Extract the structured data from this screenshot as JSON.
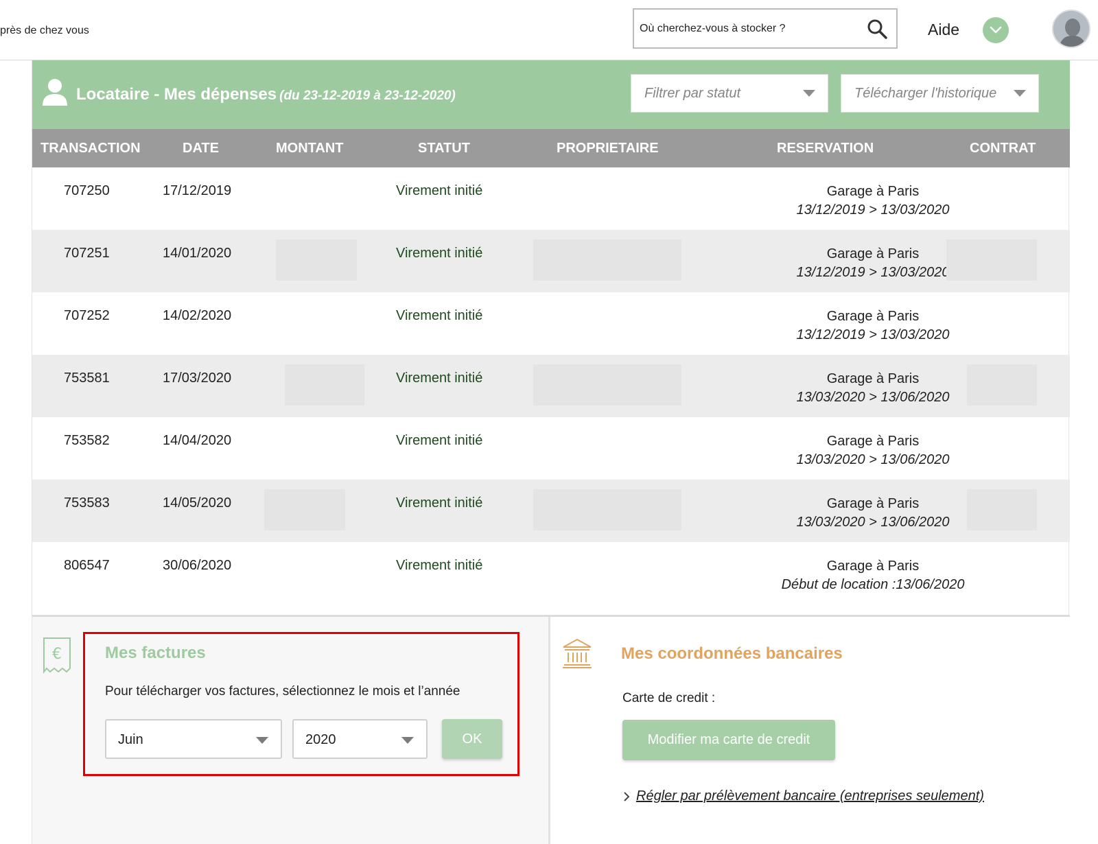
{
  "header": {
    "tagline": "près de chez vous",
    "search_placeholder": "Où cherchez-vous à stocker ?",
    "help_label": "Aide"
  },
  "panel": {
    "title": "Locataire - Mes dépenses",
    "date_range": "(du 23-12-2019 à 23-12-2020)",
    "filter_label": "Filtrer par statut",
    "download_label": "Télécharger l'historique"
  },
  "table": {
    "columns": [
      "TRANSACTION",
      "DATE",
      "MONTANT",
      "STATUT",
      "PROPRIETAIRE",
      "RESERVATION",
      "CONTRAT"
    ],
    "rows": [
      {
        "transaction": "707250",
        "date": "17/12/2019",
        "statut": "Virement initié",
        "place": "Garage à Paris",
        "period": "13/12/2019 > 13/03/2020"
      },
      {
        "transaction": "707251",
        "date": "14/01/2020",
        "statut": "Virement initié",
        "place": "Garage à Paris",
        "period": "13/12/2019 > 13/03/2020"
      },
      {
        "transaction": "707252",
        "date": "14/02/2020",
        "statut": "Virement initié",
        "place": "Garage à Paris",
        "period": "13/12/2019 > 13/03/2020"
      },
      {
        "transaction": "753581",
        "date": "17/03/2020",
        "statut": "Virement initié",
        "place": "Garage à Paris",
        "period": "13/03/2020 > 13/06/2020"
      },
      {
        "transaction": "753582",
        "date": "14/04/2020",
        "statut": "Virement initié",
        "place": "Garage à Paris",
        "period": "13/03/2020 > 13/06/2020"
      },
      {
        "transaction": "753583",
        "date": "14/05/2020",
        "statut": "Virement initié",
        "place": "Garage à Paris",
        "period": "13/03/2020 > 13/06/2020"
      },
      {
        "transaction": "806547",
        "date": "30/06/2020",
        "statut": "Virement initié",
        "place": "Garage à Paris",
        "period": "Début de location :13/06/2020"
      }
    ]
  },
  "invoices": {
    "title": "Mes factures",
    "instructions": "Pour télécharger vos factures, sélectionnez le mois et l’année",
    "month_value": "Juin",
    "year_value": "2020",
    "ok_label": "OK"
  },
  "bank": {
    "title": "Mes coordonnées bancaires",
    "card_label": "Carte de credit :",
    "modify_card_label": "Modifier ma carte de credit",
    "direct_debit_link": "Régler par prélèvement bancaire (entreprises seulement)"
  },
  "colors": {
    "green": "#9dca9f",
    "header_gray": "#9b9b9b",
    "orange": "#e0a45e",
    "highlight_red": "#e00000"
  }
}
